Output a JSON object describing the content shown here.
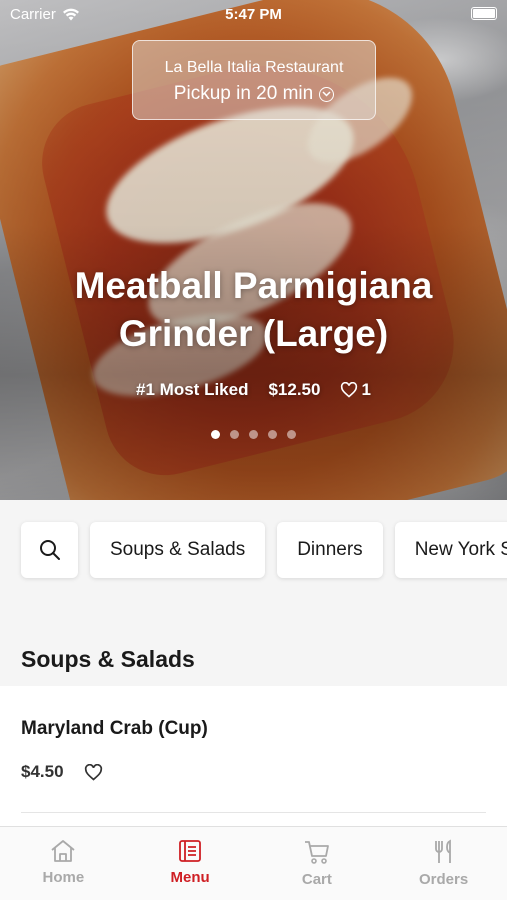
{
  "status_bar": {
    "carrier": "Carrier",
    "time": "5:47 PM"
  },
  "hero": {
    "restaurant": "La Bella Italia Restaurant",
    "pickup": "Pickup in 20 min",
    "item_title_line1": "Meatball Parmigiana",
    "item_title_line2": "Grinder (Large)",
    "badge": "#1 Most Liked",
    "price": "$12.50",
    "likes": "1",
    "carousel": {
      "count": 5,
      "active_index": 0
    }
  },
  "categories": [
    "Soups & Salads",
    "Dinners",
    "New York Style Pizza"
  ],
  "section": {
    "title": "Soups & Salads"
  },
  "menu_items": [
    {
      "name": "Maryland Crab (Cup)",
      "price": "$4.50"
    }
  ],
  "tabbar": {
    "items": [
      {
        "label": "Home",
        "icon": "home-icon",
        "active": false
      },
      {
        "label": "Menu",
        "icon": "menu-icon",
        "active": true
      },
      {
        "label": "Cart",
        "icon": "cart-icon",
        "active": false
      },
      {
        "label": "Orders",
        "icon": "orders-icon",
        "active": false
      }
    ],
    "active_color": "#cf1f24",
    "inactive_color": "#a9a9a9"
  }
}
